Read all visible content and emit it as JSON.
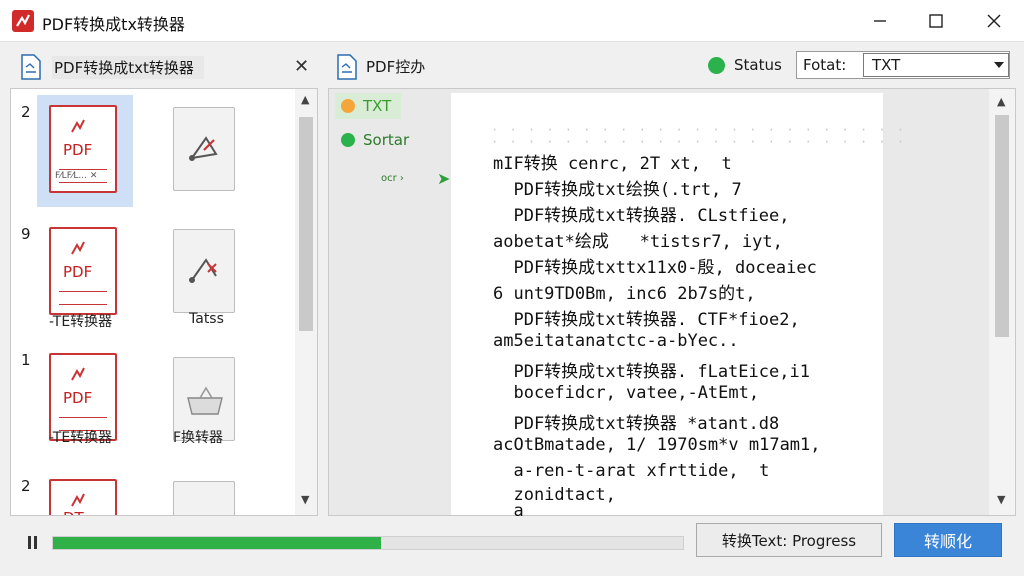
{
  "window": {
    "title": "PDF转换成tx转换器"
  },
  "left_panel": {
    "title": "PDF转换成txt转换器",
    "close_glyph": "✕",
    "rows": [
      {
        "number": "2",
        "pdf_label": "PDF",
        "pdf_footer": "F⁄LF⁄L... ✕",
        "caption": ""
      },
      {
        "number": "9",
        "pdf_label": "PDF",
        "pdf_footer": "",
        "caption_left": "-TE转换器",
        "caption_right": "Tatss"
      },
      {
        "number": "1",
        "pdf_label": "PDF",
        "pdf_footer": "",
        "caption_left": "-TE转换器",
        "caption_right": "F换转器"
      },
      {
        "number": "2",
        "pdf_label": "DT",
        "pdf_footer": "",
        "caption": ""
      }
    ]
  },
  "center": {
    "title": "PDF控办",
    "status_label": "Status",
    "format_label": "Fotat:",
    "format_value": "TXT",
    "tags": [
      {
        "label": "TXT",
        "color": "#f5a63b"
      },
      {
        "label": "Sortar",
        "color": "#2bb24c"
      }
    ],
    "small_link": "ocr ›",
    "preview_lines": [
      "mIF转换 cenrc, 2T xt,  t",
      "  PDF转换成txt绘换(.trt, 7",
      "  PDF转换成txt转换器. CLstfiee,",
      "aobetat*绘成   *tistsr7, iyt,",
      "  PDF转换成txttx11x0-殷, doceaiec",
      "6 unt9TD0Bm, inc6 2b7s的t,",
      "  PDF转换成txt转换器. CTF*fioe2,",
      "am5eitatanatctc-a-bYec..",
      "  PDF转换成txt转换器. fLatEice,i1",
      "  bocefidcr, vatee,-AtEmt,",
      "  PDF转换成txt转换器 *atant.d8",
      "acOtBmatade, 1/ 1970sm*v m17am1,",
      "  a-ren-t-arat xfrttide,  t",
      "  zonidtact,",
      "  a"
    ]
  },
  "footer": {
    "progress_fraction": 0.52,
    "progress_button": "转换Text: Progress",
    "convert_button": "转顺化"
  },
  "colors": {
    "accent": "#3a85d8",
    "progress": "#2fb147",
    "pdf_red": "#c93535",
    "selected_row": "#cfe0f6"
  }
}
